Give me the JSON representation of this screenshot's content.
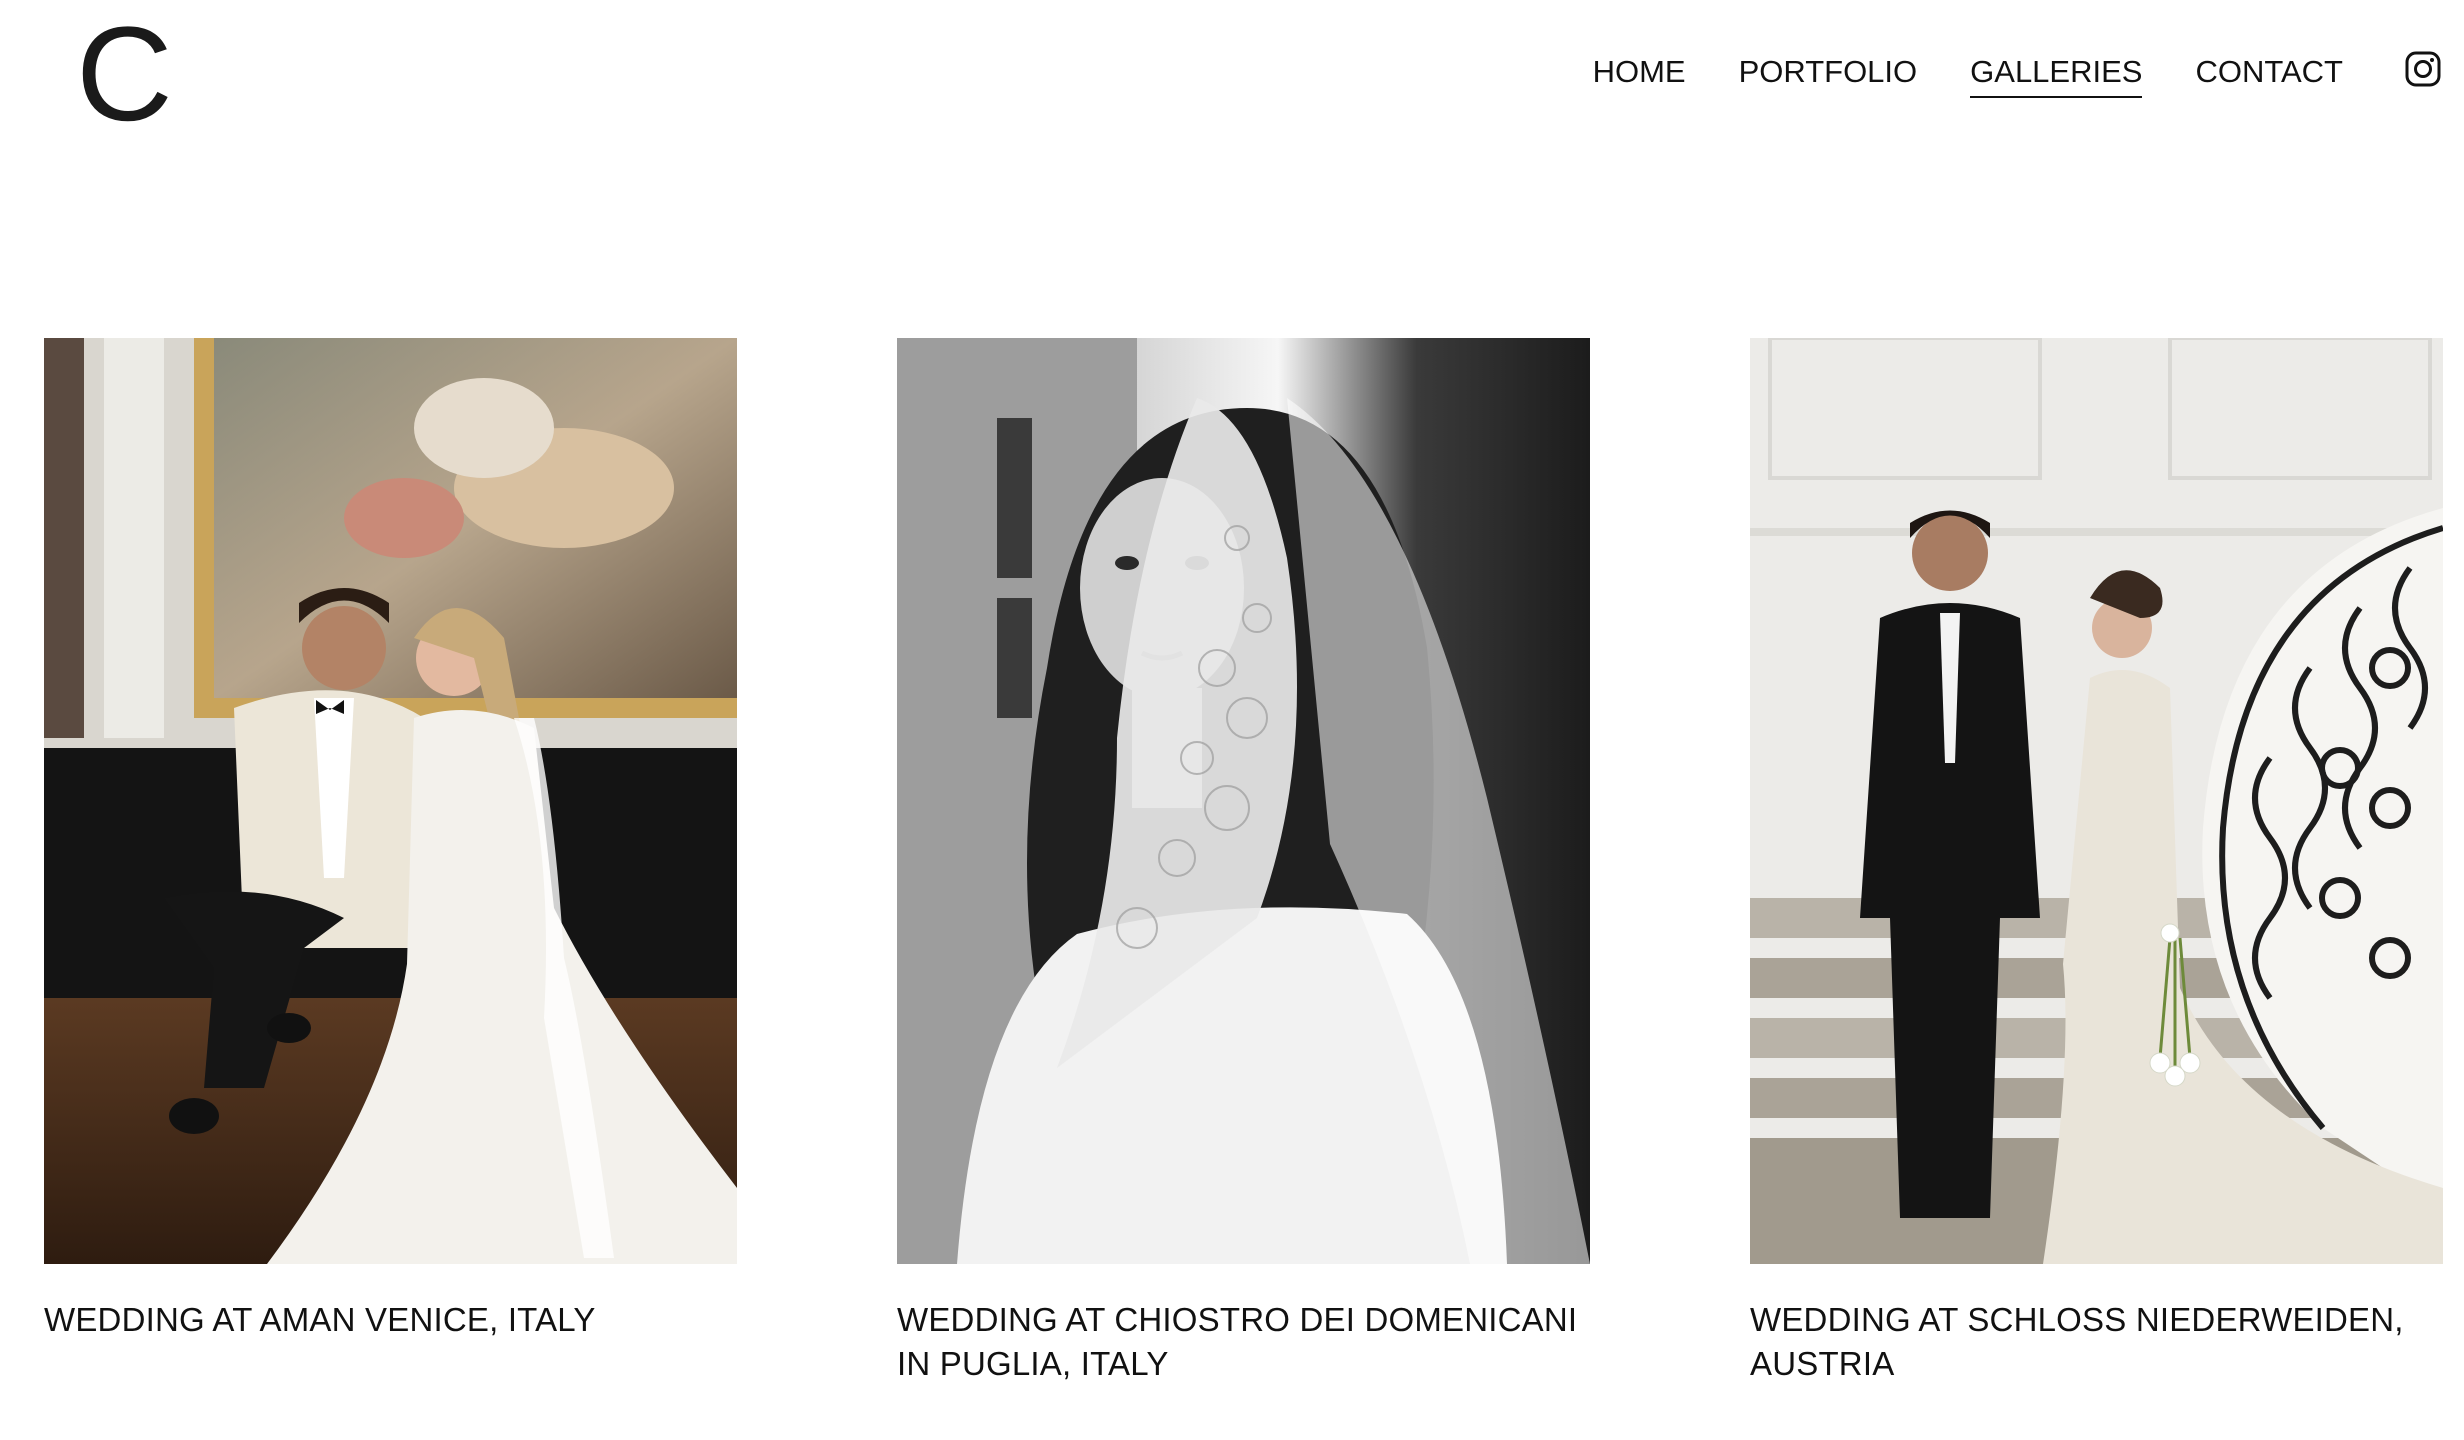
{
  "header": {
    "logo": "C",
    "nav": [
      {
        "label": "HOME",
        "active": false
      },
      {
        "label": "PORTFOLIO",
        "active": false
      },
      {
        "label": "GALLERIES",
        "active": true
      },
      {
        "label": "CONTACT",
        "active": false
      }
    ],
    "social_icon": "instagram-icon"
  },
  "galleries": [
    {
      "title": "WEDDING AT AMAN VENICE, ITALY",
      "photo": "couple-kissing-in-frescoed-palazzo"
    },
    {
      "title": "WEDDING AT CHIOSTRO DEI DOMENICANI IN PUGLIA, ITALY",
      "photo": "bride-with-lace-veil-black-and-white"
    },
    {
      "title": "WEDDING AT SCHLOSS NIEDERWEIDEN, AUSTRIA",
      "photo": "couple-on-marble-staircase"
    }
  ]
}
